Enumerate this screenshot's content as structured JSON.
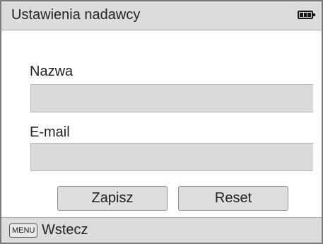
{
  "header": {
    "title": "Ustawienia nadawcy",
    "battery_icon": "battery-full-icon"
  },
  "form": {
    "name_label": "Nazwa",
    "name_value": "",
    "email_label": "E-mail",
    "email_value": ""
  },
  "buttons": {
    "save_label": "Zapisz",
    "reset_label": "Reset"
  },
  "footer": {
    "menu_key": "MENU",
    "back_label": "Wstecz"
  }
}
